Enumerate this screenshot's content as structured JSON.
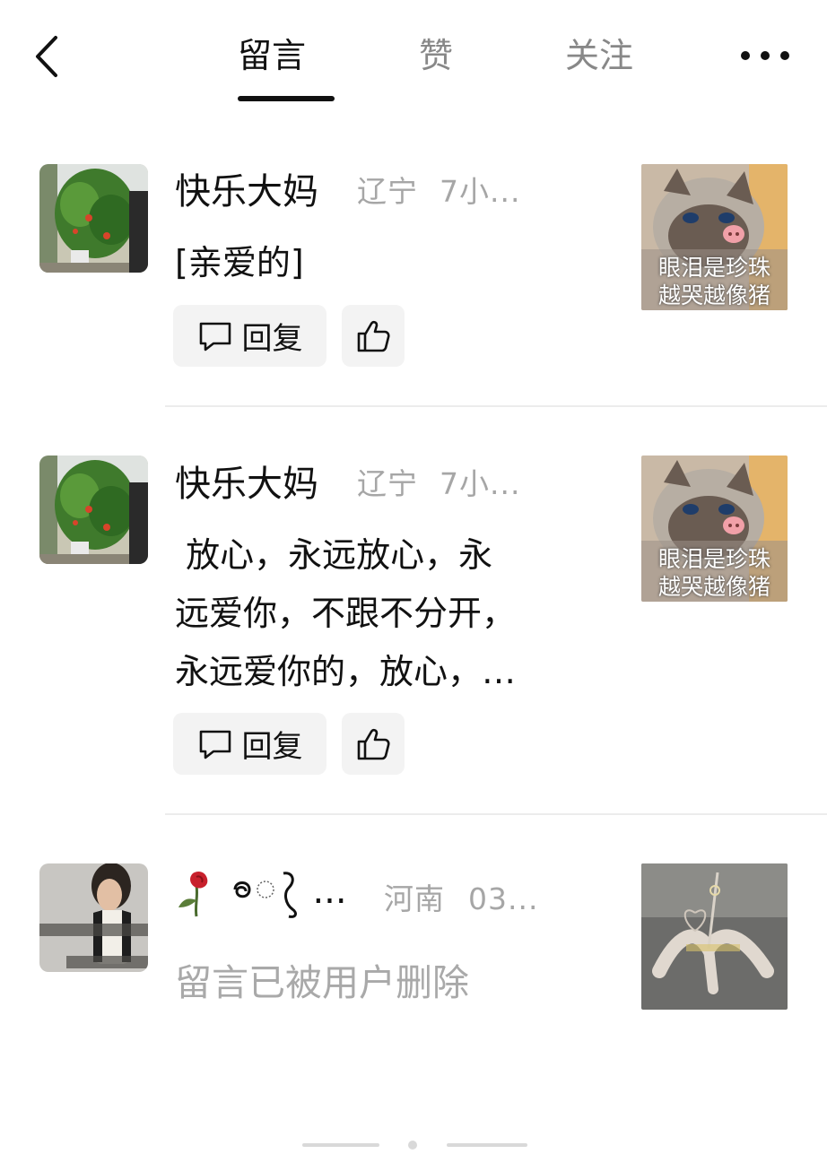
{
  "header": {
    "tabs": [
      {
        "label": "留言",
        "active": true
      },
      {
        "label": "赞",
        "active": false
      },
      {
        "label": "关注",
        "active": false
      }
    ],
    "back_icon": "chevron-left-icon",
    "more_icon": "more-horizontal-icon"
  },
  "comments": [
    {
      "username": "快乐大妈",
      "location": "辽宁",
      "time": "7小...",
      "text": "[亲爱的]",
      "reply_label": "回复",
      "thumb_caption": [
        "眼泪是珍珠",
        "越哭越像猪"
      ]
    },
    {
      "username": "快乐大妈",
      "location": "辽宁",
      "time": "7小...",
      "text_lines": [
        " 放心，永远放心，永",
        "远爱你，不跟不分开，",
        "永远爱你的，放心，…"
      ],
      "reply_label": "回复",
      "thumb_caption": [
        "眼泪是珍珠",
        "越哭越像猪"
      ]
    },
    {
      "username": "...",
      "location": "河南",
      "time": "03...",
      "deleted_text": "留言已被用户删除"
    }
  ],
  "colors": {
    "background": "#ffffff",
    "text_primary": "#111111",
    "text_secondary": "#a6a6a6",
    "button_bg": "#f3f3f3"
  }
}
